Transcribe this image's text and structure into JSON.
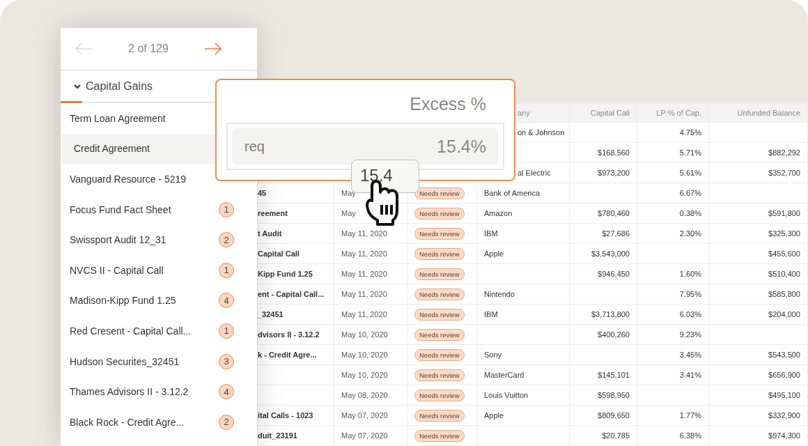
{
  "pager": {
    "position": "2 of 129",
    "prev_disabled": true,
    "next_disabled": false
  },
  "section": {
    "label": "Capital Gains",
    "expanded": true
  },
  "documents": [
    {
      "name": "Term Loan Agreement",
      "selected": false
    },
    {
      "name": "Credit Agreement",
      "selected": true
    },
    {
      "name": "Vanguard Resource - 5219",
      "selected": false
    },
    {
      "name": "Focus Fund Fact Sheet",
      "count": "1",
      "selected": false
    },
    {
      "name": "Swissport Audit 12_31",
      "count": "2",
      "selected": false
    },
    {
      "name": "NVCS II - Capital Call",
      "count": "1",
      "selected": false
    },
    {
      "name": "Madison-Kipp Fund 1.25",
      "count": "4",
      "selected": false
    },
    {
      "name": "Red Cresent - Capital Call...",
      "count": "1",
      "selected": false
    },
    {
      "name": "Hudson Securites_32451",
      "count": "3",
      "selected": false
    },
    {
      "name": "Thames Advisors II - 3.12.2",
      "count": "4",
      "selected": false
    },
    {
      "name": "Black Rock - Credit Agre...",
      "count": "2",
      "selected": false
    }
  ],
  "table": {
    "columns": {
      "company": "any",
      "capital_call": "Capital Call",
      "lp_pct": "LP % of Cap.",
      "unfunded": "Unfunded Balance"
    },
    "rows": [
      {
        "company": "on & Johnson",
        "lp_pct": "4.75%"
      },
      {
        "capital_call": "$168,560",
        "lp_pct": "5.71%",
        "unfunded": "$882,292"
      },
      {
        "company": "al Electric",
        "capital_call": "$973,200",
        "lp_pct": "5.61%",
        "unfunded": "$352,700"
      },
      {
        "document": "45",
        "date": "May",
        "status": "Needs review",
        "company": "Bank of America",
        "lp_pct": "6.67%"
      },
      {
        "document": "reement",
        "date": "May",
        "status": "Needs review",
        "company": "Amazon",
        "capital_call": "$780,460",
        "lp_pct": "0.38%",
        "unfunded": "$591,800"
      },
      {
        "document": "t Audit",
        "date": "May 11, 2020",
        "status": "Needs review",
        "company": "IBM",
        "capital_call": "$27,686",
        "lp_pct": "2.30%",
        "unfunded": "$325,300"
      },
      {
        "document": "Capital Call",
        "date": "May 11, 2020",
        "status": "Needs review",
        "company": "Apple",
        "capital_call": "$3,543,000",
        "unfunded": "$455,600"
      },
      {
        "document": "Kipp Fund 1.25",
        "date": "May 11, 2020",
        "status": "Needs review",
        "capital_call": "$946,450",
        "lp_pct": "1.60%",
        "unfunded": "$510,400"
      },
      {
        "document": "ent - Capital Call...",
        "date": "May 11, 2020",
        "status": "Needs review",
        "company": "Nintendo",
        "lp_pct": "7.95%",
        "unfunded": "$585,800"
      },
      {
        "document": "_32451",
        "date": "May 11, 2020",
        "status": "Needs review",
        "company": "IBM",
        "capital_call": "$3,713,800",
        "lp_pct": "6.03%",
        "unfunded": "$204,000"
      },
      {
        "document": "dvisors II - 3.12.2",
        "date": "May 10, 2020",
        "status": "Needs review",
        "capital_call": "$400,260",
        "lp_pct": "9.23%"
      },
      {
        "document": "k - Credit Agre...",
        "date": "May 10, 2020",
        "status": "Needs review",
        "company": "Sony",
        "lp_pct": "3.45%",
        "unfunded": "$543,500"
      },
      {
        "date": "May 10, 2020",
        "status": "Needs review",
        "company": "MasterCard",
        "capital_call": "$145,101",
        "lp_pct": "3.41%",
        "unfunded": "$656,900"
      },
      {
        "date": "May 08, 2020",
        "status": "Needs review",
        "company": "Louis Vuitton",
        "capital_call": "$598,950",
        "unfunded": "$495,100"
      },
      {
        "document": "ital Calls - 1023",
        "date": "May 07, 2020",
        "status": "Needs review",
        "company": "Apple",
        "capital_call": "$809,650",
        "lp_pct": "1.77%",
        "unfunded": "$332,900"
      },
      {
        "document": "duit_23191",
        "date": "May 07, 2020",
        "status": "Needs review",
        "capital_call": "$20,785",
        "lp_pct": "6.38%",
        "unfunded": "$974,300"
      }
    ]
  },
  "popup": {
    "title": "Excess %",
    "field": {
      "label": "req",
      "value": "15.4%"
    }
  },
  "tooltip": "15.4"
}
